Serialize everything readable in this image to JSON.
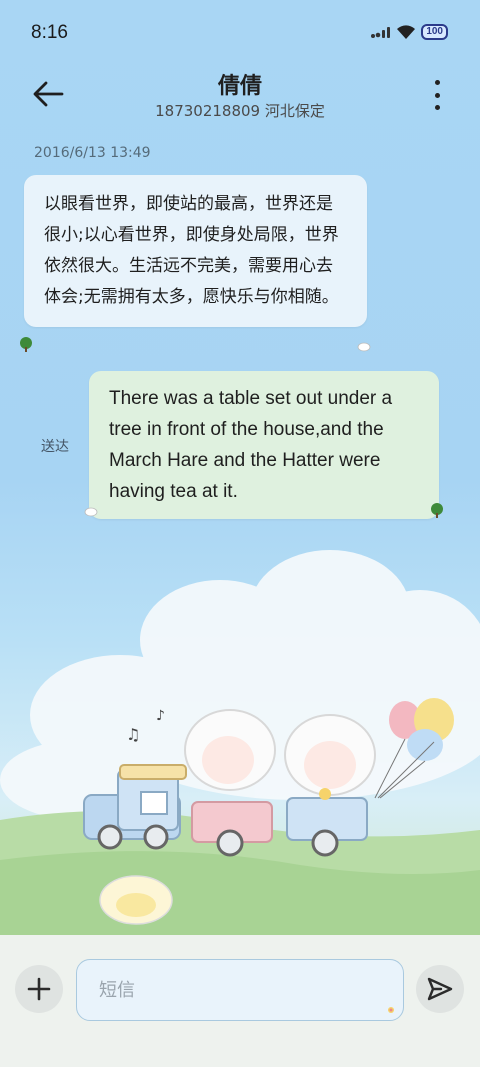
{
  "status_bar": {
    "time": "8:16",
    "battery": "100"
  },
  "header": {
    "title": "倩倩",
    "subtitle": "18730218809 河北保定"
  },
  "conversation": {
    "timestamp": "2016/6/13 13:49",
    "incoming_message": "以眼看世界，即使站的最高，世界还是很小;以心看世界，即使身处局限，世界依然很大。生活远不完美，需要用心去体会;无需拥有太多，愿快乐与你相随。",
    "outgoing_message": "There was a table set out under a tree in front of the house,and the March Hare and the Hatter were having tea at it.",
    "delivery_status": "送达"
  },
  "composer": {
    "placeholder": "短信"
  },
  "icons": {
    "back": "arrow-left-icon",
    "menu": "more-vertical-icon",
    "add": "plus-icon",
    "send": "send-icon"
  }
}
